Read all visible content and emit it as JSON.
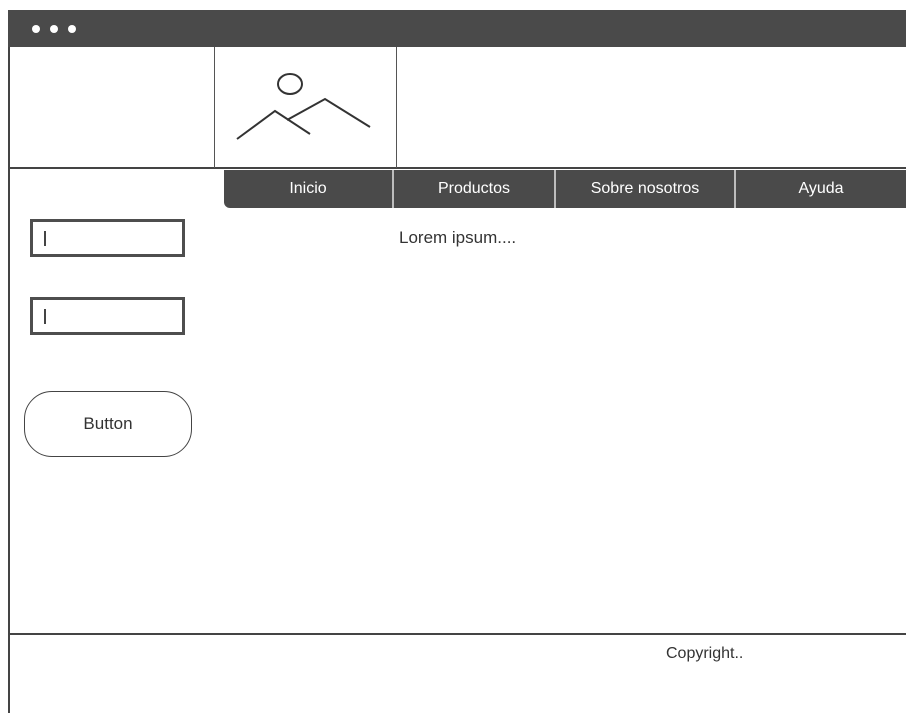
{
  "nav": {
    "items": [
      {
        "label": "Inicio"
      },
      {
        "label": "Productos"
      },
      {
        "label": "Sobre nosotros"
      },
      {
        "label": "Ayuda"
      }
    ]
  },
  "sidebar": {
    "input1": {
      "value": ""
    },
    "input2": {
      "value": ""
    },
    "button_label": "Button"
  },
  "main": {
    "text": "Lorem ipsum...."
  },
  "footer": {
    "text": "Copyright.."
  },
  "colors": {
    "chrome": "#4a4a4a",
    "border": "#444444"
  },
  "icons": {
    "logo": "image-placeholder-icon"
  }
}
